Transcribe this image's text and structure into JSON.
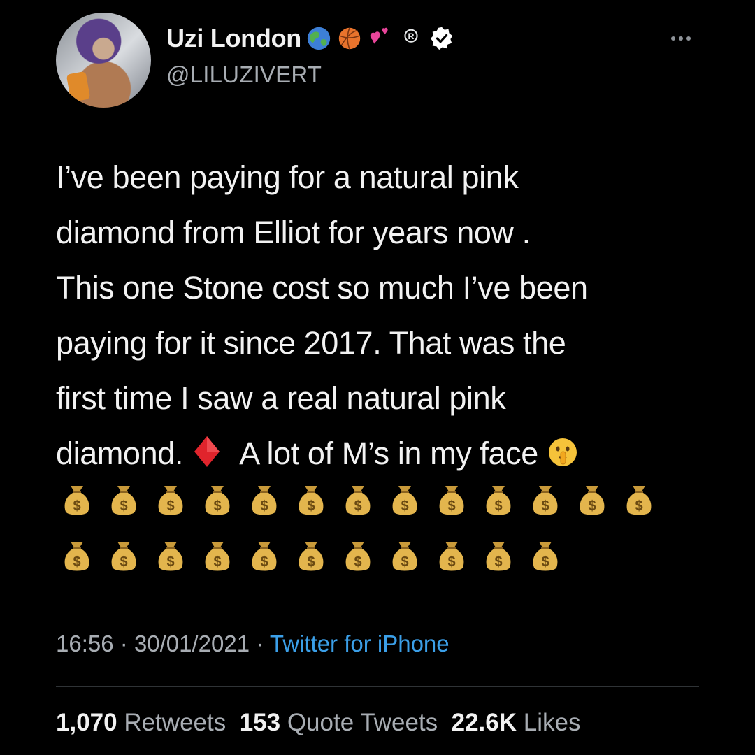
{
  "author": {
    "display_name": "Uzi London",
    "handle": "@LILUZIVERT",
    "name_emojis": [
      "globe-icon",
      "basketball-icon",
      "two-hearts-icon",
      "registered-icon",
      "verified-badge-icon"
    ]
  },
  "tweet": {
    "lines": [
      "I’ve been paying for a natural pink",
      "diamond from Elliot for years now .",
      "This one Stone cost so much I’ve been",
      "paying for it since 2017. That was the",
      "first time I saw a real natural pink"
    ],
    "last_line_start": "diamond.",
    "last_line_end": "A lot of M’s in my face",
    "emojis": [
      "red-diamond-icon",
      "shushing-face-icon"
    ],
    "money_bag_rows": [
      13,
      11
    ]
  },
  "meta": {
    "time": "16:56",
    "separator": "·",
    "date": "30/01/2021",
    "source": "Twitter for iPhone"
  },
  "stats": {
    "retweets_count": "1,070",
    "retweets_label": "Retweets",
    "quotes_count": "153",
    "quotes_label": "Quote Tweets",
    "likes_count": "22.6K",
    "likes_label": "Likes"
  },
  "colors": {
    "background": "#000000",
    "text": "#f2f2f2",
    "secondary": "#a8adb3",
    "link": "#3b9fe8"
  }
}
